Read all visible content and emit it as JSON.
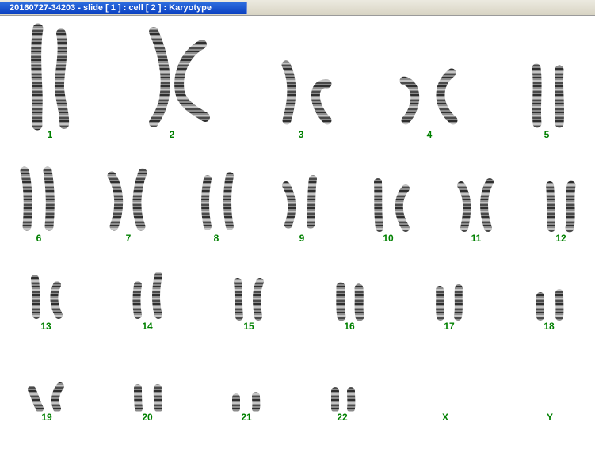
{
  "window": {
    "title": "20160727-34203 - slide [ 1 ] : cell [ 2 ] : Karyotype"
  },
  "colors": {
    "title_bg": "#0a3fc0",
    "label_green": "#008000",
    "chromosome_gray": "#5a5a5a"
  },
  "karyotype": {
    "chromosomes": [
      {
        "label": "1"
      },
      {
        "label": "2"
      },
      {
        "label": "3"
      },
      {
        "label": "4"
      },
      {
        "label": "5"
      },
      {
        "label": "6"
      },
      {
        "label": "7"
      },
      {
        "label": "8"
      },
      {
        "label": "9"
      },
      {
        "label": "10"
      },
      {
        "label": "11"
      },
      {
        "label": "12"
      },
      {
        "label": "13"
      },
      {
        "label": "14"
      },
      {
        "label": "15"
      },
      {
        "label": "16"
      },
      {
        "label": "17"
      },
      {
        "label": "18"
      },
      {
        "label": "19"
      },
      {
        "label": "20"
      },
      {
        "label": "21"
      },
      {
        "label": "22"
      },
      {
        "label": "X"
      },
      {
        "label": "Y"
      }
    ]
  }
}
